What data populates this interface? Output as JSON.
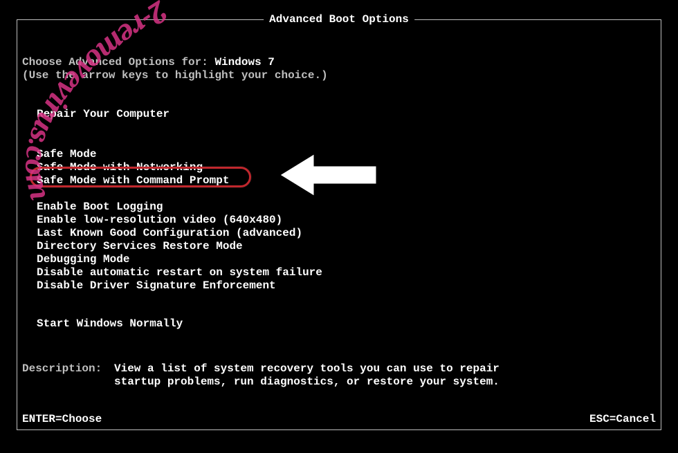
{
  "title": "Advanced Boot Options",
  "intro": {
    "line1_prefix": "Choose Advanced Options for: ",
    "os_name": "Windows 7",
    "line2": "(Use the arrow keys to highlight your choice.)"
  },
  "menu": {
    "repair": "Repair Your Computer",
    "safe_mode": "Safe Mode",
    "safe_mode_net": "Safe Mode with Networking",
    "safe_mode_cmd": "Safe Mode with Command Prompt",
    "boot_logging": "Enable Boot Logging",
    "low_res": "Enable low-resolution video (640x480)",
    "lkgc": "Last Known Good Configuration (advanced)",
    "dsrm": "Directory Services Restore Mode",
    "debug": "Debugging Mode",
    "no_auto_restart": "Disable automatic restart on system failure",
    "no_driver_sig": "Disable Driver Signature Enforcement",
    "normal": "Start Windows Normally"
  },
  "description": {
    "label": "Description:",
    "line1": "View a list of system recovery tools you can use to repair",
    "line2": "startup problems, run diagnostics, or restore your system."
  },
  "footer": {
    "enter": "ENTER=Choose",
    "esc": "ESC=Cancel"
  },
  "watermark_text": "2-removevirus.com",
  "colors": {
    "highlight_border": "#c1272d",
    "watermark": "#d63384"
  }
}
